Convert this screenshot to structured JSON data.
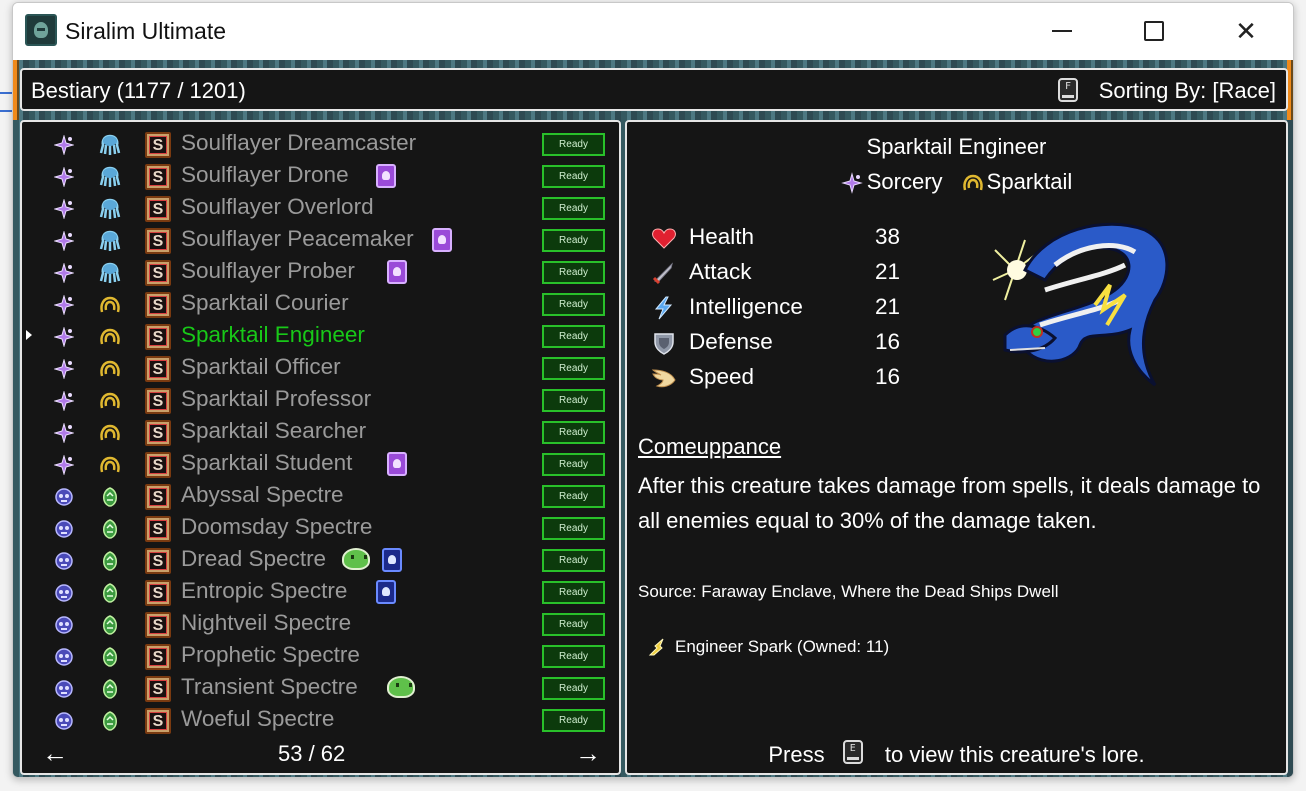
{
  "window": {
    "title": "Siralim Ultimate",
    "min_label": "",
    "max_label": "",
    "close_label": "✕"
  },
  "header": {
    "title": "Bestiary (1177 / 1201)",
    "sort_key": "F",
    "sort_label": "Sorting By: [Race]"
  },
  "list": {
    "rows": [
      {
        "name": "Soulflayer Dreamcaster",
        "class": "sorcery",
        "race": "soulflayer",
        "badges": [],
        "status": "Ready",
        "selected": false
      },
      {
        "name": "Soulflayer Drone",
        "class": "sorcery",
        "race": "soulflayer",
        "badges": [
          "purple"
        ],
        "status": "Ready",
        "selected": false
      },
      {
        "name": "Soulflayer Overlord",
        "class": "sorcery",
        "race": "soulflayer",
        "badges": [],
        "status": "Ready",
        "selected": false
      },
      {
        "name": "Soulflayer Peacemaker",
        "class": "sorcery",
        "race": "soulflayer",
        "badges": [
          "purple"
        ],
        "status": "Ready",
        "selected": false
      },
      {
        "name": "Soulflayer Prober",
        "class": "sorcery",
        "race": "soulflayer",
        "badges": [
          "purple"
        ],
        "status": "Ready",
        "selected": false
      },
      {
        "name": "Sparktail Courier",
        "class": "sorcery",
        "race": "sparktail",
        "badges": [],
        "status": "Ready",
        "selected": false
      },
      {
        "name": "Sparktail Engineer",
        "class": "sorcery",
        "race": "sparktail",
        "badges": [],
        "status": "Ready",
        "selected": true
      },
      {
        "name": "Sparktail Officer",
        "class": "sorcery",
        "race": "sparktail",
        "badges": [],
        "status": "Ready",
        "selected": false
      },
      {
        "name": "Sparktail Professor",
        "class": "sorcery",
        "race": "sparktail",
        "badges": [],
        "status": "Ready",
        "selected": false
      },
      {
        "name": "Sparktail Searcher",
        "class": "sorcery",
        "race": "sparktail",
        "badges": [],
        "status": "Ready",
        "selected": false
      },
      {
        "name": "Sparktail Student",
        "class": "sorcery",
        "race": "sparktail",
        "badges": [
          "purple"
        ],
        "status": "Ready",
        "selected": false
      },
      {
        "name": "Abyssal Spectre",
        "class": "death",
        "race": "spectre",
        "badges": [],
        "status": "Ready",
        "selected": false
      },
      {
        "name": "Doomsday Spectre",
        "class": "death",
        "race": "spectre",
        "badges": [],
        "status": "Ready",
        "selected": false
      },
      {
        "name": "Dread Spectre",
        "class": "death",
        "race": "spectre",
        "badges": [
          "slime",
          "blue"
        ],
        "status": "Ready",
        "selected": false
      },
      {
        "name": "Entropic Spectre",
        "class": "death",
        "race": "spectre",
        "badges": [
          "blue"
        ],
        "status": "Ready",
        "selected": false
      },
      {
        "name": "Nightveil Spectre",
        "class": "death",
        "race": "spectre",
        "badges": [],
        "status": "Ready",
        "selected": false
      },
      {
        "name": "Prophetic Spectre",
        "class": "death",
        "race": "spectre",
        "badges": [],
        "status": "Ready",
        "selected": false
      },
      {
        "name": "Transient Spectre",
        "class": "death",
        "race": "spectre",
        "badges": [
          "slime"
        ],
        "status": "Ready",
        "selected": false
      },
      {
        "name": "Woeful Spectre",
        "class": "death",
        "race": "spectre",
        "badges": [],
        "status": "Ready",
        "selected": false
      }
    ],
    "pager": {
      "prev": "←",
      "next": "→",
      "text": "53 / 62"
    }
  },
  "detail": {
    "name": "Sparktail Engineer",
    "class": "Sorcery",
    "race": "Sparktail",
    "stats": [
      {
        "label": "Health",
        "value": "38",
        "icon": "heart-icon"
      },
      {
        "label": "Attack",
        "value": "21",
        "icon": "sword-icon"
      },
      {
        "label": "Intelligence",
        "value": "21",
        "icon": "lightning-icon"
      },
      {
        "label": "Defense",
        "value": "16",
        "icon": "shield-icon"
      },
      {
        "label": "Speed",
        "value": "16",
        "icon": "wing-icon"
      }
    ],
    "trait_name": "Comeuppance",
    "trait_desc": "After this creature takes damage from spells, it deals damage to all enemies equal to 30% of the damage taken.",
    "source": "Source: Faraway Enclave, Where the Dead Ships Dwell",
    "spark": "Engineer Spark (Owned: 11)",
    "lore_prefix": "Press",
    "lore_key": "E",
    "lore_suffix": "to view this creature's lore."
  },
  "colors": {
    "selected_name": "#18c818",
    "unselected_name": "#9a9a9a",
    "ready_border": "#29c02a",
    "panel_bg": "#151515"
  }
}
